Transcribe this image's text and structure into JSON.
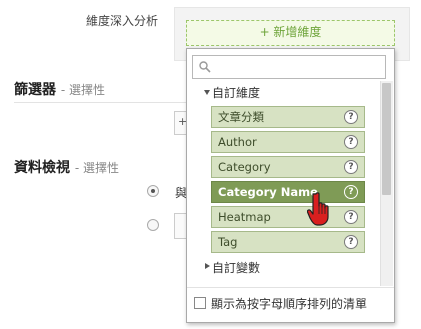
{
  "drilldown": {
    "label": "維度深入分析",
    "add_button": "+ 新增維度"
  },
  "filters": {
    "title": "篩選器",
    "optional": "- 選擇性"
  },
  "data_view": {
    "title": "資料檢視",
    "optional": "- 選擇性",
    "option1_partial": "與"
  },
  "dropdown": {
    "search_placeholder": "",
    "custom_dimensions_header": "自訂維度",
    "items": [
      {
        "label": "文章分類"
      },
      {
        "label": "Author"
      },
      {
        "label": "Category"
      },
      {
        "label": "Category Name",
        "highlighted": true
      },
      {
        "label": "Heatmap"
      },
      {
        "label": "Tag"
      }
    ],
    "help_glyph": "?",
    "custom_variables_header": "自訂變數",
    "alphabetical_label": "顯示為按字母順序排列的清單"
  },
  "colors": {
    "item_bg": "#d7e2c3",
    "item_highlight_bg": "#7f9b56",
    "add_dimension_text": "#6ea43a"
  }
}
